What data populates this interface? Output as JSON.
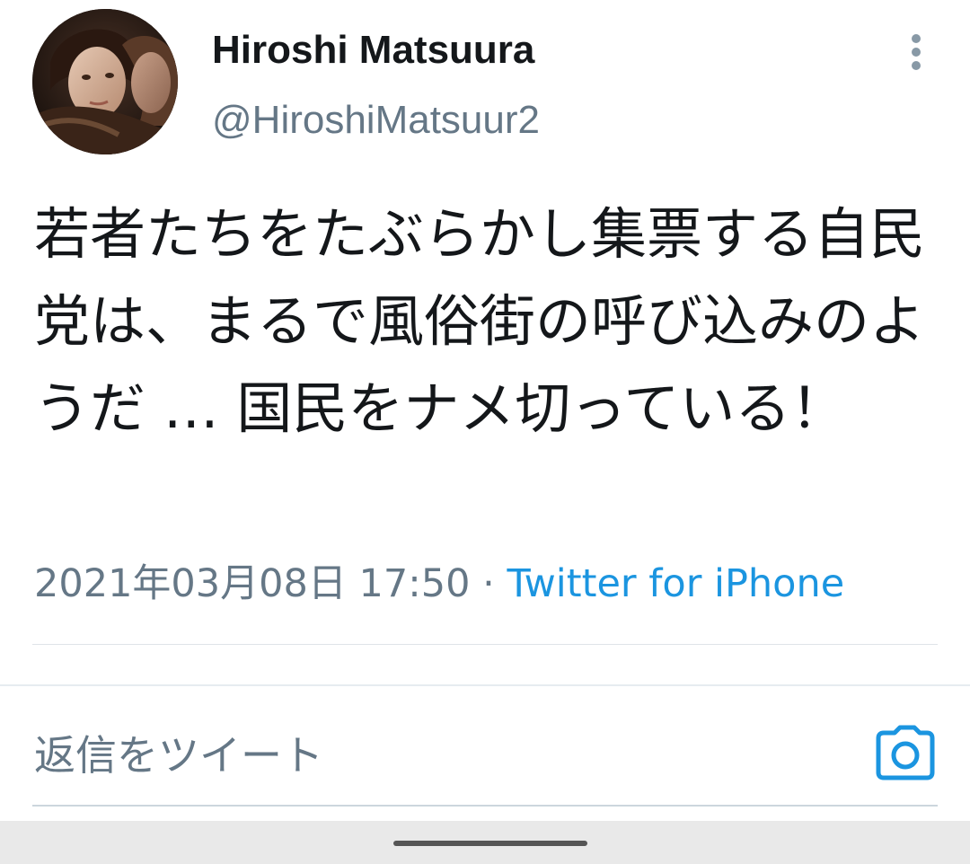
{
  "tweet": {
    "author": {
      "display_name": "Hiroshi Matsuura",
      "handle": "@HiroshiMatsuur2",
      "avatar": "profile-photo"
    },
    "text": "若者たちをたぶらかし集票する自民党は、まるで風俗街の呼び込みのようだ … 国民をナメ切っている！",
    "timestamp": "2021年03月08日 17:50",
    "separator": " · ",
    "source": "Twitter for iPhone",
    "more_icon": "more-vertical-icon"
  },
  "reply": {
    "placeholder": "返信をツイート",
    "camera_icon": "camera-icon"
  },
  "colors": {
    "text_primary": "#14171a",
    "text_secondary": "#657786",
    "link": "#1b95e0",
    "divider": "#dfe4e8",
    "nav_bar": "#e9e9e9"
  }
}
